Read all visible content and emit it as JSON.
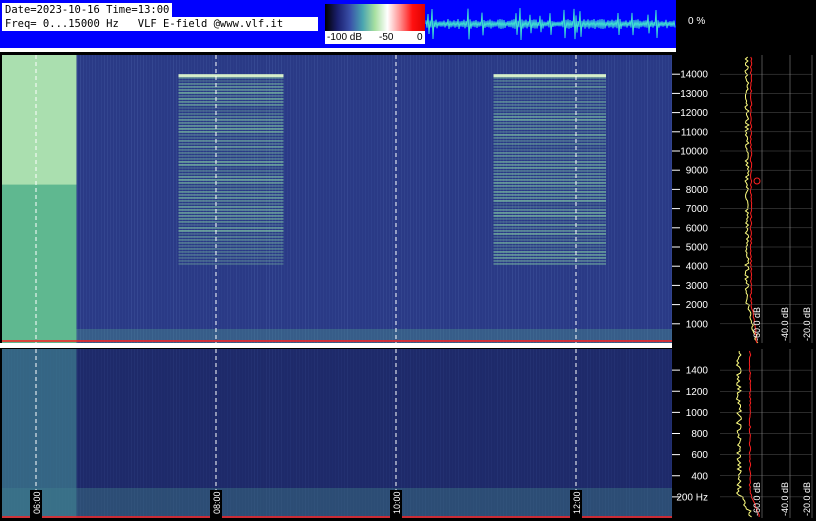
{
  "header": {
    "line1": "Date=2023-10-16 Time=13:00",
    "line2": "Freq= 0...15000 Hz   VLF E-field @www.vlf.it"
  },
  "colorbar": {
    "labels": [
      "-100 dB",
      "-50",
      "0"
    ],
    "stops": [
      "#000000",
      "#1a1f6e",
      "#3a50a8",
      "#49a4b0",
      "#a8e0a0",
      "#ffffff",
      "#ff9090",
      "#ff1010",
      "#e00000"
    ]
  },
  "activity_label": "0 %",
  "colors": {
    "background": "#000000",
    "header_band": "#0000ff",
    "waveform": "#40e0d0",
    "spectrogram_base": "#2a3a86",
    "spectrogram_bright": "#e8ffc8",
    "avg_trace": "#ffff80",
    "ref_trace": "#ff2020",
    "grid": "#ffffff"
  },
  "chart_data": [
    {
      "type": "heatmap",
      "title": "",
      "x": {
        "ticks": [
          "06:00",
          "08:00",
          "10:00",
          "12:00"
        ]
      },
      "y": {
        "range": [
          0,
          15000
        ],
        "unit": "Hz",
        "ticks": [
          1000,
          2000,
          3000,
          4000,
          5000,
          6000,
          7000,
          8000,
          9000,
          10000,
          11000,
          12000,
          13000,
          14000
        ]
      },
      "bands": [
        {
          "from": "05:30",
          "to": "06:27",
          "fmin": 0,
          "fmax": 15000,
          "level": "high"
        },
        {
          "from": "07:35",
          "to": "08:45",
          "fmin": 4000,
          "fmax": 14000,
          "level": "medium"
        },
        {
          "from": "11:05",
          "to": "12:20",
          "fmin": 4000,
          "fmax": 14000,
          "level": "medium"
        }
      ],
      "spectrum_axis_labels": [
        "-60.0 dB",
        "-40.0 dB",
        "-20.0 dB"
      ]
    },
    {
      "type": "heatmap",
      "title": "",
      "x": {
        "ticks": [
          "06:00",
          "08:00",
          "10:00",
          "12:00"
        ]
      },
      "y": {
        "range": [
          0,
          1600
        ],
        "ticks": [
          200,
          400,
          600,
          800,
          1000,
          1200,
          1400
        ],
        "tick_labels": [
          "200 Hz",
          "400",
          "600",
          "800",
          "1000",
          "1200",
          "1400"
        ]
      },
      "spectrum_axis_labels": [
        "-60.0 dB",
        "-40.0 dB",
        "-20.0 dB"
      ]
    }
  ]
}
